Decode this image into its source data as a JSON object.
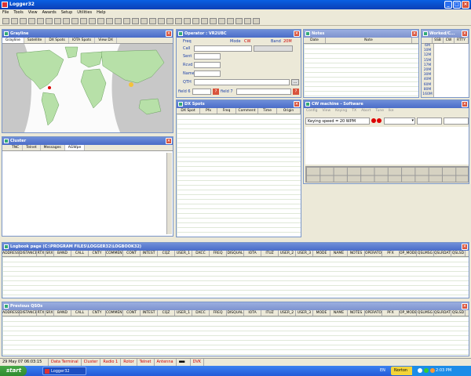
{
  "window": {
    "title": "Logger32"
  },
  "menu": [
    "File",
    "Tools",
    "View",
    "Awards",
    "Setup",
    "Utilities",
    "Help"
  ],
  "grayline": {
    "title": "Grayline",
    "tabs": [
      "Grayline",
      "Satellite",
      "DX Spots",
      "IOTA Spots",
      "View DX"
    ]
  },
  "cluster": {
    "title": "Cluster",
    "tabs": [
      "TNC",
      "Telnet",
      "Messages",
      "AGWpe"
    ]
  },
  "operator": {
    "title": "Operator : VR2UBC",
    "freq_label": "Freq",
    "mode_label": "Mode",
    "mode_value": "CW",
    "band_label": "Band",
    "band_value": "20M",
    "fields": [
      "Call",
      "Sent",
      "Rcvd",
      "Name",
      "QTH"
    ],
    "field6": "field 6",
    "field7": "field 7",
    "q": "?",
    "dots": "..."
  },
  "dxspots": {
    "title": "DX Spots",
    "columns": [
      "DX Spot",
      "Pfx",
      "Freq",
      "Comment",
      "Time",
      "Origin"
    ]
  },
  "notes": {
    "title": "Notes",
    "columns": [
      "Date",
      "Note"
    ]
  },
  "worked": {
    "title": "Worked/C...",
    "columns": [
      "",
      "SSB",
      "CW",
      "RTTY"
    ],
    "bands": [
      "6M",
      "10M",
      "12M",
      "15M",
      "17M",
      "20M",
      "30M",
      "40M",
      "60M",
      "80M",
      "160M"
    ]
  },
  "cw": {
    "title": "CW machine - Software",
    "menu": [
      "Config",
      "View",
      "Keying",
      "TX",
      "Abort",
      "Tune",
      "Ike"
    ],
    "speed": "Keying speed = 20 WPM"
  },
  "logbook": {
    "title": "Logbook page  (C:\\PROGRAM FILES\\LOGGER32\\LOGBOOK32)",
    "columns": [
      "ADDRESS",
      "DISTANCE",
      "RTX",
      "SRX",
      "BAND",
      "CALL",
      "CNTY",
      "COMMENT",
      "CONT",
      "INTEST",
      "CQZ",
      "USER_1",
      "DXCC",
      "FREQ",
      "DISQUAL",
      "IOTA",
      "ITUZ",
      "USER_2",
      "USER_3",
      "MODE",
      "NAME",
      "NOTES",
      "OPERATOR",
      "PFX",
      "OP_MODE",
      "QSLMSG",
      "QSLRDATE",
      "QSLSD"
    ]
  },
  "previous": {
    "title": "Previous QSOs"
  },
  "status": {
    "datetime": "29 May 07  06:03:15",
    "items": [
      "Data Terminal",
      "Cluster",
      "Radio 1",
      "Rotor",
      "Telnet",
      "Antenna",
      "DVK"
    ]
  },
  "taskbar": {
    "start": "start",
    "app": "Logger32",
    "lang": "EN",
    "norton": "Norton",
    "clock": "2:03 PM"
  },
  "colors": {
    "title_blue": "#0b3fb6",
    "pane_header": "#4a6cc8",
    "close_red": "#d9533c",
    "ocean": "#fbfbfb",
    "land": "#b7e0a8",
    "night": "#c8c8c8"
  }
}
